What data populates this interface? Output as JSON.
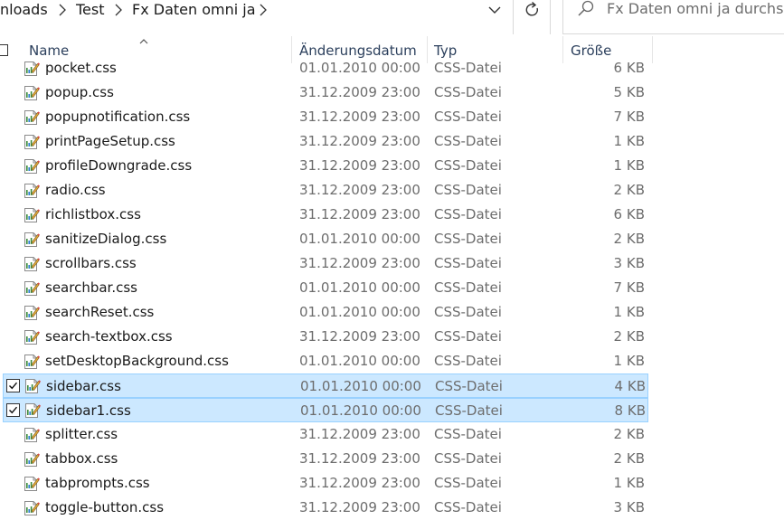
{
  "breadcrumb": {
    "items": [
      {
        "label": "nloads"
      },
      {
        "label": "Test"
      },
      {
        "label": "Fx Daten omni ja"
      }
    ]
  },
  "search": {
    "placeholder": "Fx Daten omni ja durchsuchen"
  },
  "columns": {
    "name": "Name",
    "date": "Änderungsdatum",
    "type": "Typ",
    "size": "Größe"
  },
  "files": [
    {
      "name": "pocket.css",
      "date": "01.01.2010 00:00",
      "type": "CSS-Datei",
      "size": "6 KB",
      "selected": false
    },
    {
      "name": "popup.css",
      "date": "31.12.2009 23:00",
      "type": "CSS-Datei",
      "size": "5 KB",
      "selected": false
    },
    {
      "name": "popupnotification.css",
      "date": "31.12.2009 23:00",
      "type": "CSS-Datei",
      "size": "7 KB",
      "selected": false
    },
    {
      "name": "printPageSetup.css",
      "date": "31.12.2009 23:00",
      "type": "CSS-Datei",
      "size": "1 KB",
      "selected": false
    },
    {
      "name": "profileDowngrade.css",
      "date": "31.12.2009 23:00",
      "type": "CSS-Datei",
      "size": "1 KB",
      "selected": false
    },
    {
      "name": "radio.css",
      "date": "31.12.2009 23:00",
      "type": "CSS-Datei",
      "size": "2 KB",
      "selected": false
    },
    {
      "name": "richlistbox.css",
      "date": "31.12.2009 23:00",
      "type": "CSS-Datei",
      "size": "6 KB",
      "selected": false
    },
    {
      "name": "sanitizeDialog.css",
      "date": "01.01.2010 00:00",
      "type": "CSS-Datei",
      "size": "2 KB",
      "selected": false
    },
    {
      "name": "scrollbars.css",
      "date": "31.12.2009 23:00",
      "type": "CSS-Datei",
      "size": "3 KB",
      "selected": false
    },
    {
      "name": "searchbar.css",
      "date": "01.01.2010 00:00",
      "type": "CSS-Datei",
      "size": "7 KB",
      "selected": false
    },
    {
      "name": "searchReset.css",
      "date": "01.01.2010 00:00",
      "type": "CSS-Datei",
      "size": "1 KB",
      "selected": false
    },
    {
      "name": "search-textbox.css",
      "date": "31.12.2009 23:00",
      "type": "CSS-Datei",
      "size": "2 KB",
      "selected": false
    },
    {
      "name": "setDesktopBackground.css",
      "date": "01.01.2010 00:00",
      "type": "CSS-Datei",
      "size": "1 KB",
      "selected": false
    },
    {
      "name": "sidebar.css",
      "date": "01.01.2010 00:00",
      "type": "CSS-Datei",
      "size": "4 KB",
      "selected": true
    },
    {
      "name": "sidebar1.css",
      "date": "01.01.2010 00:00",
      "type": "CSS-Datei",
      "size": "8 KB",
      "selected": true
    },
    {
      "name": "splitter.css",
      "date": "31.12.2009 23:00",
      "type": "CSS-Datei",
      "size": "2 KB",
      "selected": false
    },
    {
      "name": "tabbox.css",
      "date": "31.12.2009 23:00",
      "type": "CSS-Datei",
      "size": "2 KB",
      "selected": false
    },
    {
      "name": "tabprompts.css",
      "date": "31.12.2009 23:00",
      "type": "CSS-Datei",
      "size": "1 KB",
      "selected": false
    },
    {
      "name": "toggle-button.css",
      "date": "31.12.2009 23:00",
      "type": "CSS-Datei",
      "size": "3 KB",
      "selected": false
    }
  ],
  "icons": {
    "separator": "chevron-right-icon",
    "history": "chevron-down-icon",
    "refresh": "refresh-icon",
    "search": "search-icon",
    "file": "css-file-icon",
    "sort": "sort-up-icon"
  },
  "colors": {
    "selection_bg": "#cce8ff",
    "selection_border": "#99d1ff",
    "header_text": "#2b3f5c",
    "secondary_text": "#6d6d6d"
  }
}
